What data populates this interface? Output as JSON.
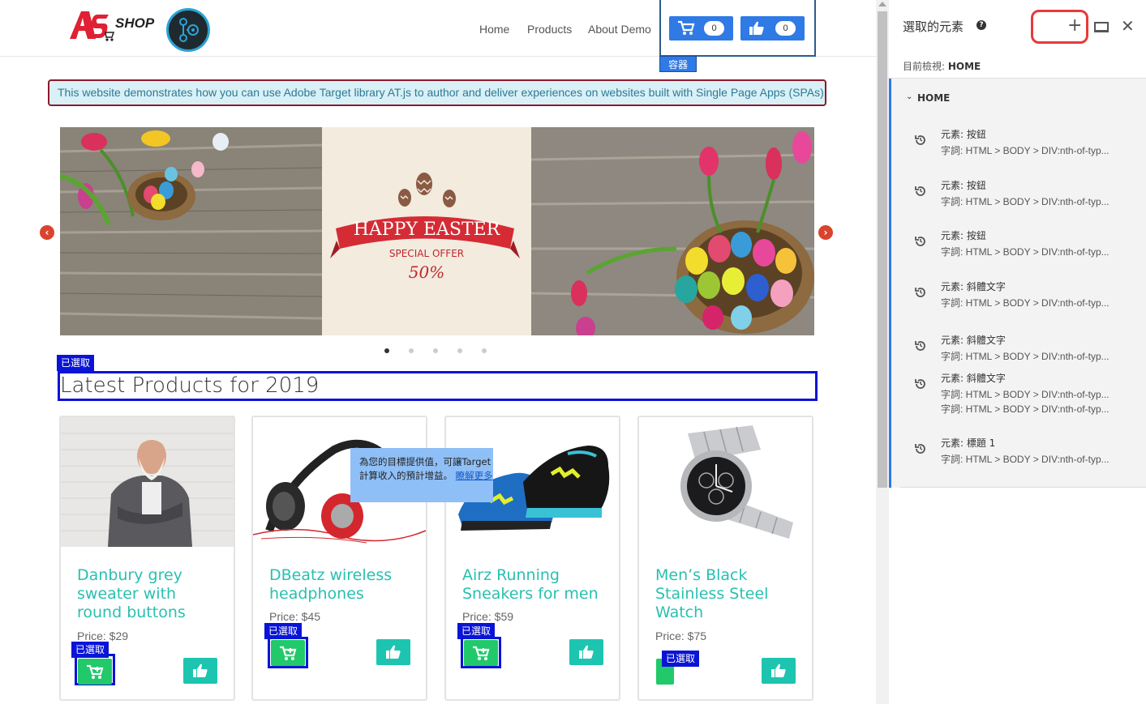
{
  "header": {
    "logo_text": "SHOP",
    "nav": [
      "Home",
      "Products",
      "About Demo"
    ],
    "cart_count": "0",
    "like_count": "0",
    "container_tag": "容器"
  },
  "banner_text": "This website demonstrates how you can use Adobe Target library AT.js to author and deliver experiences on websites built with Single Page Apps (SPAs).",
  "hero": {
    "line1": "HAPPY EASTER",
    "line2": "SPECIAL OFFER",
    "line3": "50%",
    "slide_count": 5,
    "active_slide": 1
  },
  "selected_tag": "已選取",
  "section_title": "Latest Products for 2019",
  "products": [
    {
      "name": "Danbury grey sweater with round buttons",
      "price": "Price: $29"
    },
    {
      "name": "DBeatz wireless headphones",
      "price": "Price: $45"
    },
    {
      "name": "Airz Running Sneakers for men",
      "price": "Price: $59"
    },
    {
      "name": "Men’s Black Stainless Steel Watch",
      "price": "Price: $75"
    }
  ],
  "tooltip": {
    "text": "為您的目標提供值，可讓Target計算收入的預計增益。",
    "link": "瞭解更多"
  },
  "panel": {
    "title": "選取的元素",
    "help": "?",
    "add": "+",
    "close": "✕",
    "viewing_label": "目前檢視:",
    "viewing_value": "HOME",
    "group": "HOME",
    "items": [
      {
        "element": "元素: 按鈕",
        "selector": "字詞: HTML > BODY > DIV:nth-of-typ..."
      },
      {
        "element": "元素: 按鈕",
        "selector": "字詞: HTML > BODY > DIV:nth-of-typ..."
      },
      {
        "element": "元素: 按鈕",
        "selector": "字詞: HTML > BODY > DIV:nth-of-typ..."
      },
      {
        "element": "元素: 斜體文字",
        "selector": "字詞: HTML > BODY > DIV:nth-of-typ..."
      },
      {
        "element": "元素: 斜體文字",
        "selector": "字詞: HTML > BODY > DIV:nth-of-typ..."
      },
      {
        "element": "元素: 斜體文字",
        "selector": "字詞: HTML > BODY > DIV:nth-of-typ...",
        "selector2": "字詞: HTML > BODY > DIV:nth-of-typ..."
      },
      {
        "element": "元素: 標題 1",
        "selector": "字詞: HTML > BODY > DIV:nth-of-typ..."
      }
    ]
  },
  "colors": {
    "accent_blue": "#2f7ae5",
    "selection_blue": "#0a14d6",
    "teal": "#29c0b0",
    "cart_green": "#21c96b",
    "highlight_red": "#e8393a"
  }
}
